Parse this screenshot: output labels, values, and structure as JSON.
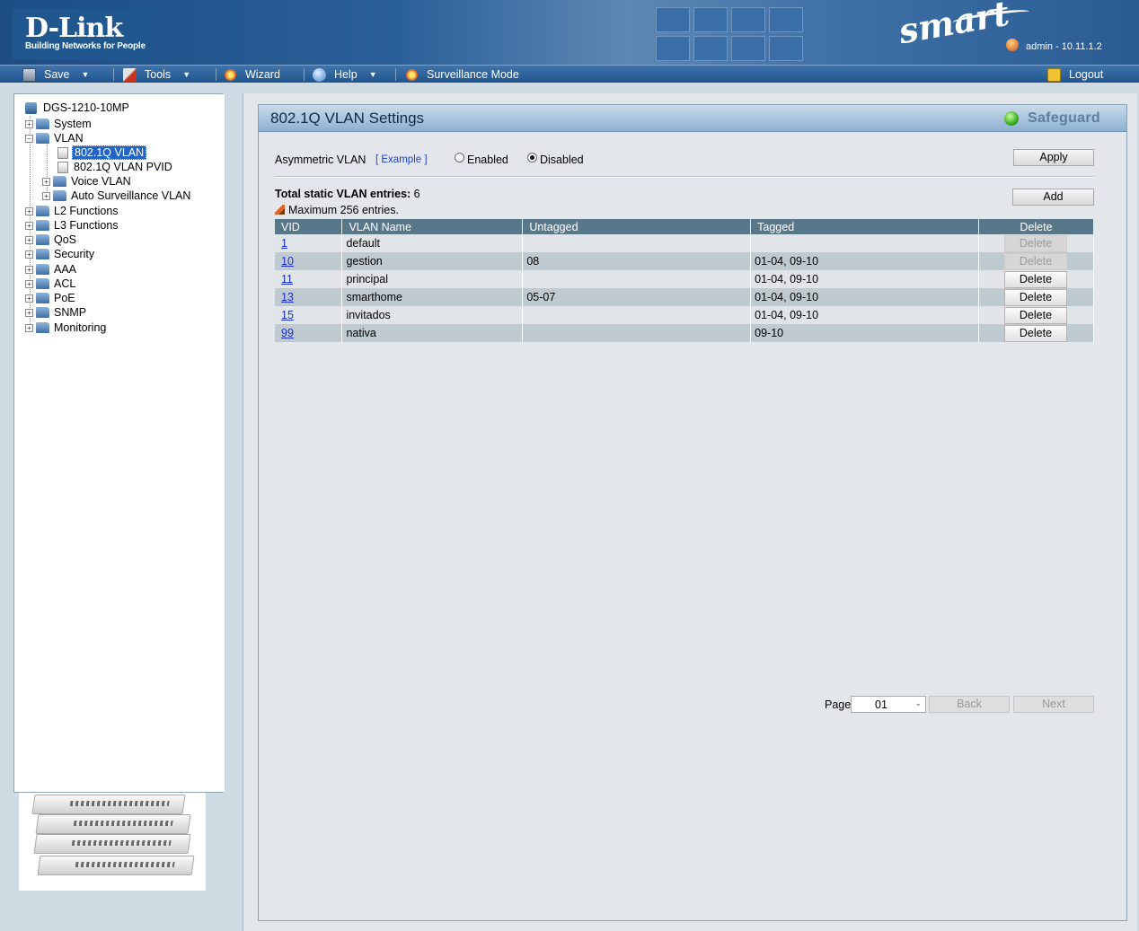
{
  "header": {
    "logo_text": "D-Link",
    "logo_tagline": "Building Networks for People",
    "smart_logo": "smart",
    "user_label": "admin - 10.11.1.2"
  },
  "menu": {
    "save": "Save",
    "tools": "Tools",
    "wizard": "Wizard",
    "help": "Help",
    "surveillance": "Surveillance Mode",
    "logout": "Logout"
  },
  "tree": {
    "device": "DGS-1210-10MP",
    "system": "System",
    "vlan": "VLAN",
    "vlan_8021q": "802.1Q VLAN",
    "vlan_pvid": "802.1Q VLAN PVID",
    "voice_vlan": "Voice VLAN",
    "auto_surv_vlan": "Auto Surveillance VLAN",
    "l2": "L2 Functions",
    "l3": "L3 Functions",
    "qos": "QoS",
    "security": "Security",
    "aaa": "AAA",
    "acl": "ACL",
    "poe": "PoE",
    "snmp": "SNMP",
    "monitoring": "Monitoring"
  },
  "content": {
    "title": "802.1Q VLAN Settings",
    "safeguard": "Safeguard",
    "asym_label": "Asymmetric VLAN",
    "example_link": "[ Example ]",
    "enabled": "Enabled",
    "disabled": "Disabled",
    "asym_state": "Disabled",
    "apply": "Apply",
    "total_label": "Total static VLAN entries:",
    "total_value": "6",
    "max_entries": "Maximum 256 entries.",
    "add": "Add"
  },
  "table": {
    "headers": [
      "VID",
      "VLAN Name",
      "Untagged",
      "Tagged",
      "Delete"
    ],
    "rows": [
      {
        "vid": "1",
        "name": "default",
        "untagged": "",
        "tagged": "",
        "delete": "Delete",
        "delete_enabled": false
      },
      {
        "vid": "10",
        "name": "gestion",
        "untagged": "08",
        "tagged": "01-04, 09-10",
        "delete": "Delete",
        "delete_enabled": false
      },
      {
        "vid": "11",
        "name": "principal",
        "untagged": "",
        "tagged": "01-04, 09-10",
        "delete": "Delete",
        "delete_enabled": true
      },
      {
        "vid": "13",
        "name": "smarthome",
        "untagged": "05-07",
        "tagged": "01-04, 09-10",
        "delete": "Delete",
        "delete_enabled": true
      },
      {
        "vid": "15",
        "name": "invitados",
        "untagged": "",
        "tagged": "01-04, 09-10",
        "delete": "Delete",
        "delete_enabled": true
      },
      {
        "vid": "99",
        "name": "nativa",
        "untagged": "",
        "tagged": "09-10",
        "delete": "Delete",
        "delete_enabled": true
      }
    ]
  },
  "pagination": {
    "page_label": "Page",
    "page_value": "01",
    "back": "Back",
    "next": "Next"
  },
  "colors": {
    "header_blue": "#2a6099",
    "menu_blue": "#1f548d",
    "table_header": "#587889",
    "row_light": "#e1e5e8",
    "row_dark": "#bfc9d0",
    "selected": "#2264c7"
  }
}
